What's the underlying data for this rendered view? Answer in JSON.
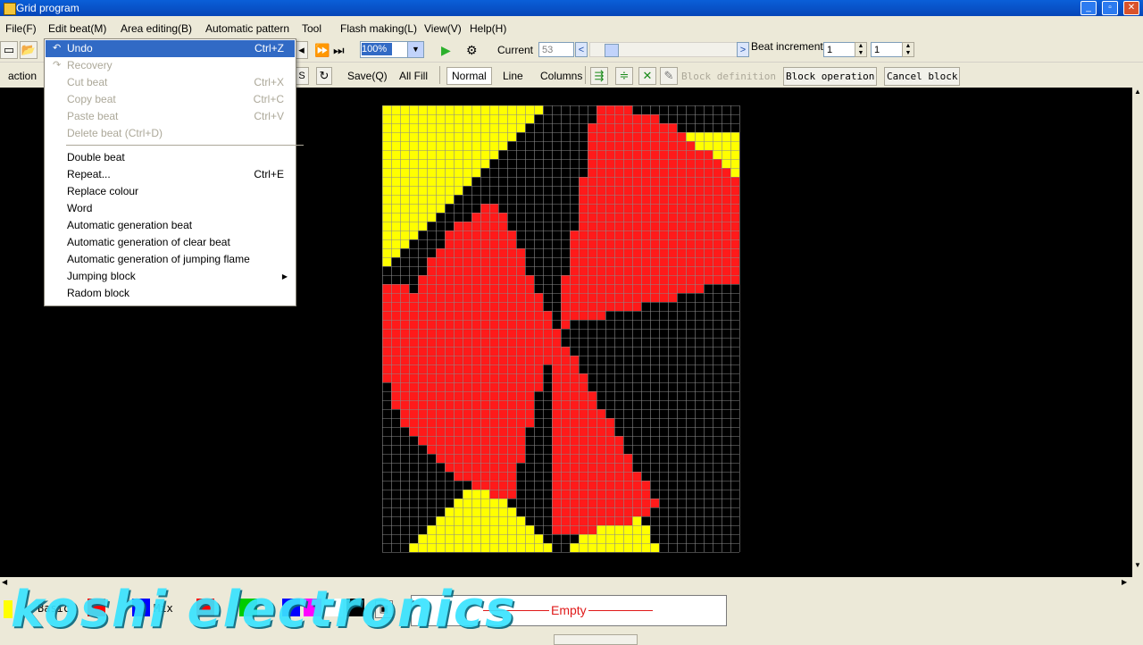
{
  "window": {
    "title": "Grid program"
  },
  "menubar": {
    "items": [
      "File(F)",
      "Edit beat(M)",
      "Area editing(B)",
      "Automatic pattern",
      "Tool",
      "Flash making(L)",
      "View(V)",
      "Help(H)"
    ]
  },
  "toolbar": {
    "zoom": "100%",
    "current_label": "Current",
    "current_value": "53",
    "beat_increment_label": "Beat increment",
    "beat_increment_a": "1",
    "beat_increment_b": "1"
  },
  "toolbar2": {
    "action_label": "action",
    "save": "Save(Q)",
    "all_fill": "All Fill",
    "normal": "Normal",
    "line": "Line",
    "columns": "Columns",
    "block_definition": "Block definition",
    "block_operation": "Block operation",
    "cancel_block": "Cancel block"
  },
  "dropdown": {
    "items": [
      {
        "label": "Undo",
        "shortcut": "Ctrl+Z",
        "state": "highlighted"
      },
      {
        "label": "Recovery",
        "shortcut": "",
        "state": "disabled"
      },
      {
        "label": "Cut beat",
        "shortcut": "Ctrl+X",
        "state": "disabled"
      },
      {
        "label": "Copy beat",
        "shortcut": "Ctrl+C",
        "state": "disabled"
      },
      {
        "label": "Paste beat",
        "shortcut": "Ctrl+V",
        "state": "disabled"
      },
      {
        "label": "Delete beat (Ctrl+D)",
        "shortcut": "",
        "state": "disabled"
      },
      {
        "label": "Double beat",
        "shortcut": "",
        "state": "normal"
      },
      {
        "label": "Repeat...",
        "shortcut": "Ctrl+E",
        "state": "normal"
      },
      {
        "label": "Replace colour",
        "shortcut": "",
        "state": "normal"
      },
      {
        "label": "Word",
        "shortcut": "",
        "state": "normal"
      },
      {
        "label": "Automatic generation beat",
        "shortcut": "",
        "state": "normal"
      },
      {
        "label": "Automatic generation of clear beat",
        "shortcut": "",
        "state": "normal"
      },
      {
        "label": "Automatic generation of jumping flame",
        "shortcut": "",
        "state": "normal"
      },
      {
        "label": "Jumping block",
        "shortcut": "",
        "state": "submenu"
      },
      {
        "label": "Radom block",
        "shortcut": "",
        "state": "normal"
      }
    ]
  },
  "grid": {
    "columns": 40,
    "rows": 50,
    "colors": {
      "red": "#ff1a1a",
      "yellow": "#ffff00",
      "background": "#000000",
      "gridline": "#8a8a8a"
    }
  },
  "status": {
    "basic_label": "Basic",
    "mix_label": "Mix",
    "empty_label": "Empty",
    "palette": [
      "#ff0000",
      "#00cc00",
      "#0000ff",
      "#ff00ff",
      "#ffffff",
      "#000000"
    ]
  },
  "watermark": {
    "text": "koshi electronics"
  }
}
